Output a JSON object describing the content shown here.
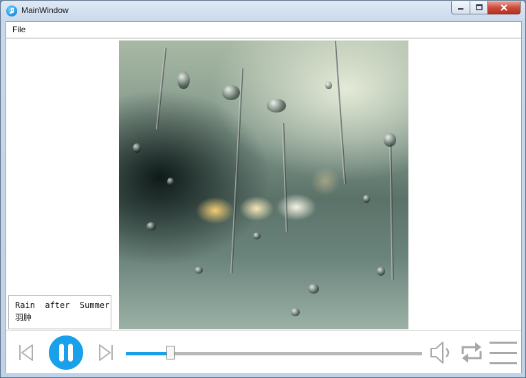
{
  "window": {
    "title": "MainWindow",
    "icon": "music-note-icon"
  },
  "menubar": {
    "items": [
      "File"
    ]
  },
  "album_cover": {
    "description_icon": "album-art-image"
  },
  "now_playing": {
    "title": "Rain  after  Summer",
    "artist": "羽肿"
  },
  "player": {
    "state": "playing",
    "progress_fraction": 0.15,
    "accent_color": "#18a0ea",
    "controls": {
      "previous": "skip-previous-icon",
      "play_pause": "pause-icon",
      "next": "skip-next-icon",
      "volume": "volume-icon",
      "repeat": "repeat-icon",
      "playlist": "menu-list-icon"
    }
  }
}
